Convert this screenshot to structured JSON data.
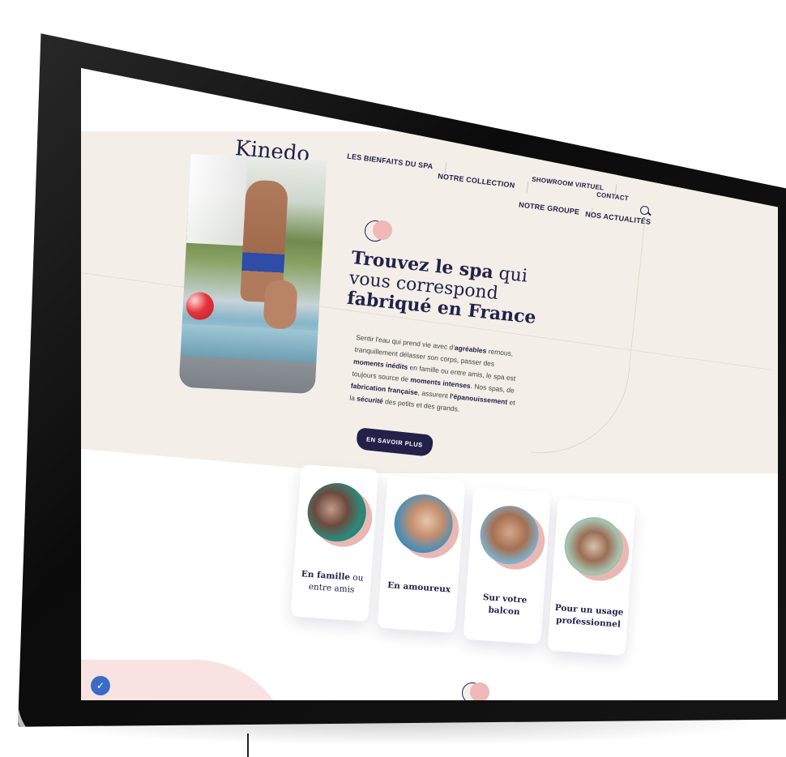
{
  "site": {
    "logo": "Kinedo"
  },
  "nav": {
    "items": [
      {
        "label": "LES BIENFAITS DU SPA"
      },
      {
        "label": "NOTRE COLLECTION"
      },
      {
        "label": "NOTRE GROUPE"
      },
      {
        "label": "NOS ACTUALITÉS"
      },
      {
        "label": "SHOWROOM VIRTUEL"
      },
      {
        "label": "CONTACT"
      }
    ]
  },
  "hero": {
    "title_part1_bold": "Trouvez le spa",
    "title_part1_rest": " qui",
    "title_line2": "vous correspond",
    "title_line3": "fabriqué en France",
    "paragraph": [
      {
        "text": "Sentir l'eau qui prend vie avec d'",
        "bold": false
      },
      {
        "text": "agréables",
        "bold": true
      },
      {
        "text": " remous, tranquillement délasser son corps, passer des ",
        "bold": false
      },
      {
        "text": "moments inédits",
        "bold": true
      },
      {
        "text": " en famille ou entre amis, le spa est toujours source de ",
        "bold": false
      },
      {
        "text": "moments intenses",
        "bold": true
      },
      {
        "text": ". Nos spas, de ",
        "bold": false
      },
      {
        "text": "fabrication française",
        "bold": true
      },
      {
        "text": ", assurent ",
        "bold": false
      },
      {
        "text": "l'épanouissement",
        "bold": true
      },
      {
        "text": " et la ",
        "bold": false
      },
      {
        "text": "sécurité",
        "bold": true
      },
      {
        "text": " des petits et des grands.",
        "bold": false
      }
    ],
    "cta_label": "EN SAVOIR PLUS"
  },
  "cards": [
    {
      "label_bold": "En famille",
      "label_rest": " ou entre amis"
    },
    {
      "label_bold": "En amoureux",
      "label_rest": ""
    },
    {
      "label_bold": "Sur votre balcon",
      "label_rest": ""
    },
    {
      "label_bold": "Pour un usage professionnel",
      "label_rest": ""
    }
  ],
  "colors": {
    "navy": "#23214a",
    "cream": "#f3efe8",
    "pink": "#f0b8b8",
    "badge_blue": "#3a6cc7"
  },
  "icons": {
    "search": "search-icon",
    "chat": "chat-icon"
  }
}
